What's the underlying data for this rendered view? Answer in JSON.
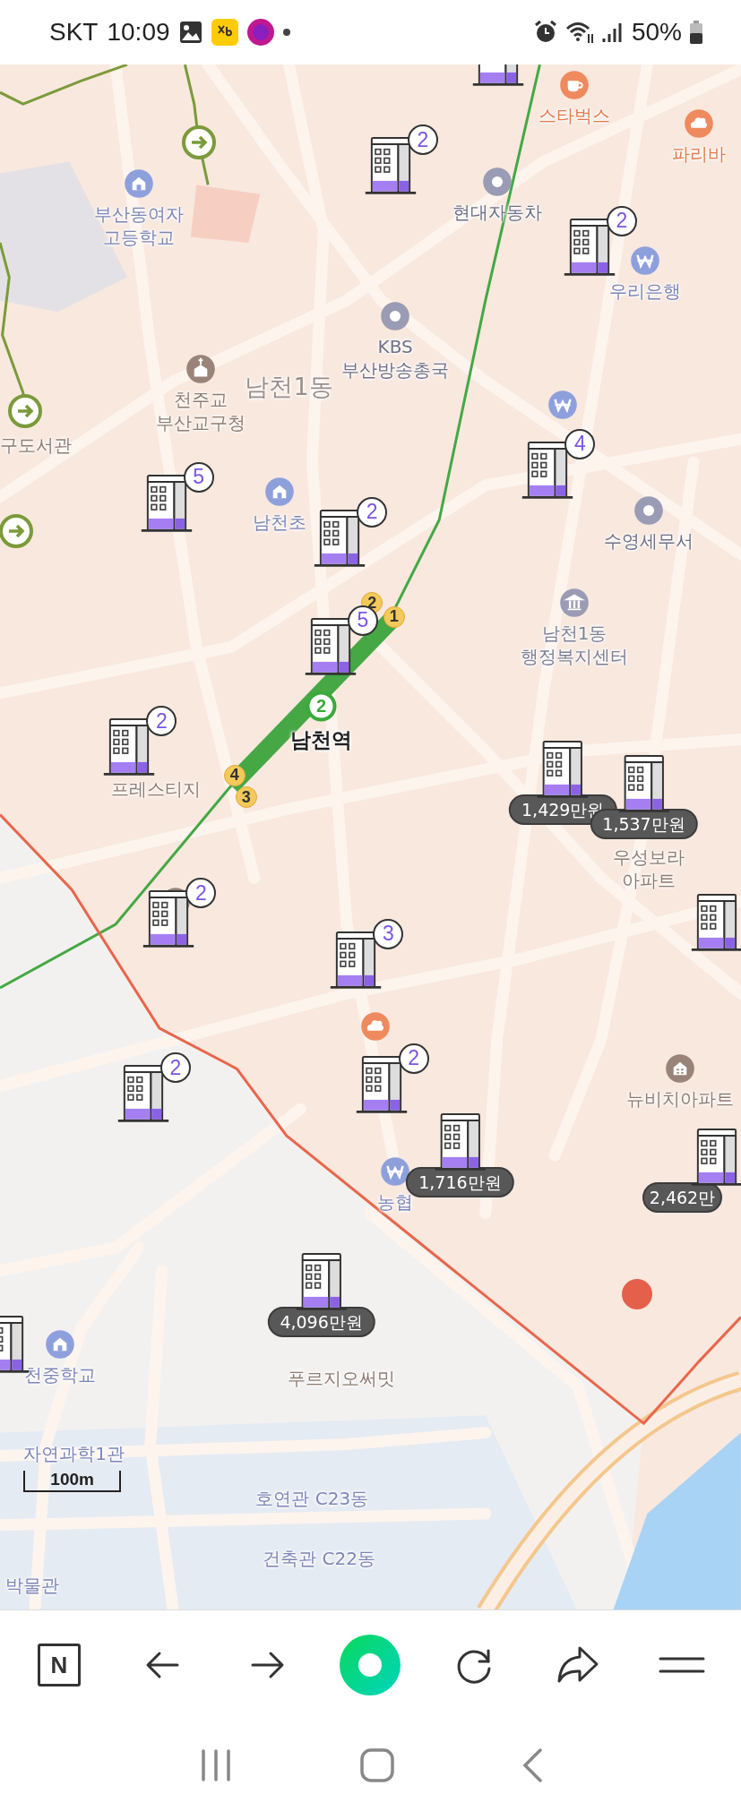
{
  "status_bar": {
    "carrier": "SKT",
    "time": "10:09",
    "battery": "50%"
  },
  "map": {
    "places": [
      {
        "kind": "cafe",
        "lines": [
          "스타벅스"
        ]
      },
      {
        "kind": "bakery",
        "lines": [
          "파리바"
        ]
      },
      {
        "kind": "landmark",
        "lines": [
          "현대자동차"
        ]
      },
      {
        "kind": "school",
        "lines": [
          "부산동여자",
          "고등학교"
        ]
      },
      {
        "kind": "bank",
        "lines": [
          "우리은행"
        ]
      },
      {
        "kind": "landmark",
        "lines": [
          "KBS",
          "부산방송총국"
        ]
      },
      {
        "kind": "area",
        "lines": [
          "남천1동"
        ]
      },
      {
        "kind": "church",
        "lines": [
          "천주교",
          "부산교구청"
        ]
      },
      {
        "kind": "text",
        "lines": [
          "구도서관"
        ]
      },
      {
        "kind": "bank"
      },
      {
        "kind": "landmark",
        "lines": [
          "수영세무서"
        ]
      },
      {
        "kind": "school",
        "lines": [
          "남천초"
        ]
      },
      {
        "kind": "civic",
        "lines": [
          "남천1동",
          "행정복지센터"
        ]
      },
      {
        "kind": "station",
        "line": "2",
        "lines": [
          "남천역"
        ]
      },
      {
        "kind": "text",
        "lines": [
          "프레스티지"
        ]
      },
      {
        "kind": "text",
        "lines": [
          "우성보라",
          "아파트"
        ]
      },
      {
        "kind": "apartment"
      },
      {
        "kind": "bakery"
      },
      {
        "kind": "apartment",
        "lines": [
          "뉴비치아파트"
        ]
      },
      {
        "kind": "bank",
        "lines": [
          "농협"
        ]
      },
      {
        "kind": "text",
        "lines": [
          "푸르지오써밋"
        ]
      },
      {
        "kind": "school",
        "lines": [
          "천중학교"
        ]
      },
      {
        "kind": "campus",
        "lines": [
          "자연과학1관"
        ]
      },
      {
        "kind": "campus",
        "lines": [
          "호연관 C23동"
        ]
      },
      {
        "kind": "campus",
        "lines": [
          "건축관 C22동"
        ]
      },
      {
        "kind": "campus",
        "lines": [
          "박물관"
        ]
      }
    ],
    "markers": [
      {
        "kind": "plain"
      },
      {
        "kind": "count",
        "label": "2"
      },
      {
        "kind": "count",
        "label": "2"
      },
      {
        "kind": "count",
        "label": "5"
      },
      {
        "kind": "count",
        "label": "2"
      },
      {
        "kind": "count",
        "label": "4"
      },
      {
        "kind": "count",
        "label": "5"
      },
      {
        "kind": "count",
        "label": "2"
      },
      {
        "kind": "price",
        "label": "1,429만원"
      },
      {
        "kind": "price",
        "label": "1,537만원"
      },
      {
        "kind": "plain"
      },
      {
        "kind": "count",
        "label": "2"
      },
      {
        "kind": "count",
        "label": "3"
      },
      {
        "kind": "count",
        "label": "2"
      },
      {
        "kind": "count",
        "label": "2"
      },
      {
        "kind": "price",
        "label": "1,716만원"
      },
      {
        "kind": "price",
        "label": "2,462만"
      },
      {
        "kind": "price",
        "label": "4,096만원"
      },
      {
        "kind": "plain"
      }
    ],
    "exits": [
      "2",
      "1",
      "4",
      "3"
    ],
    "scale": "100m"
  },
  "toolbar": {
    "logo": "N"
  }
}
